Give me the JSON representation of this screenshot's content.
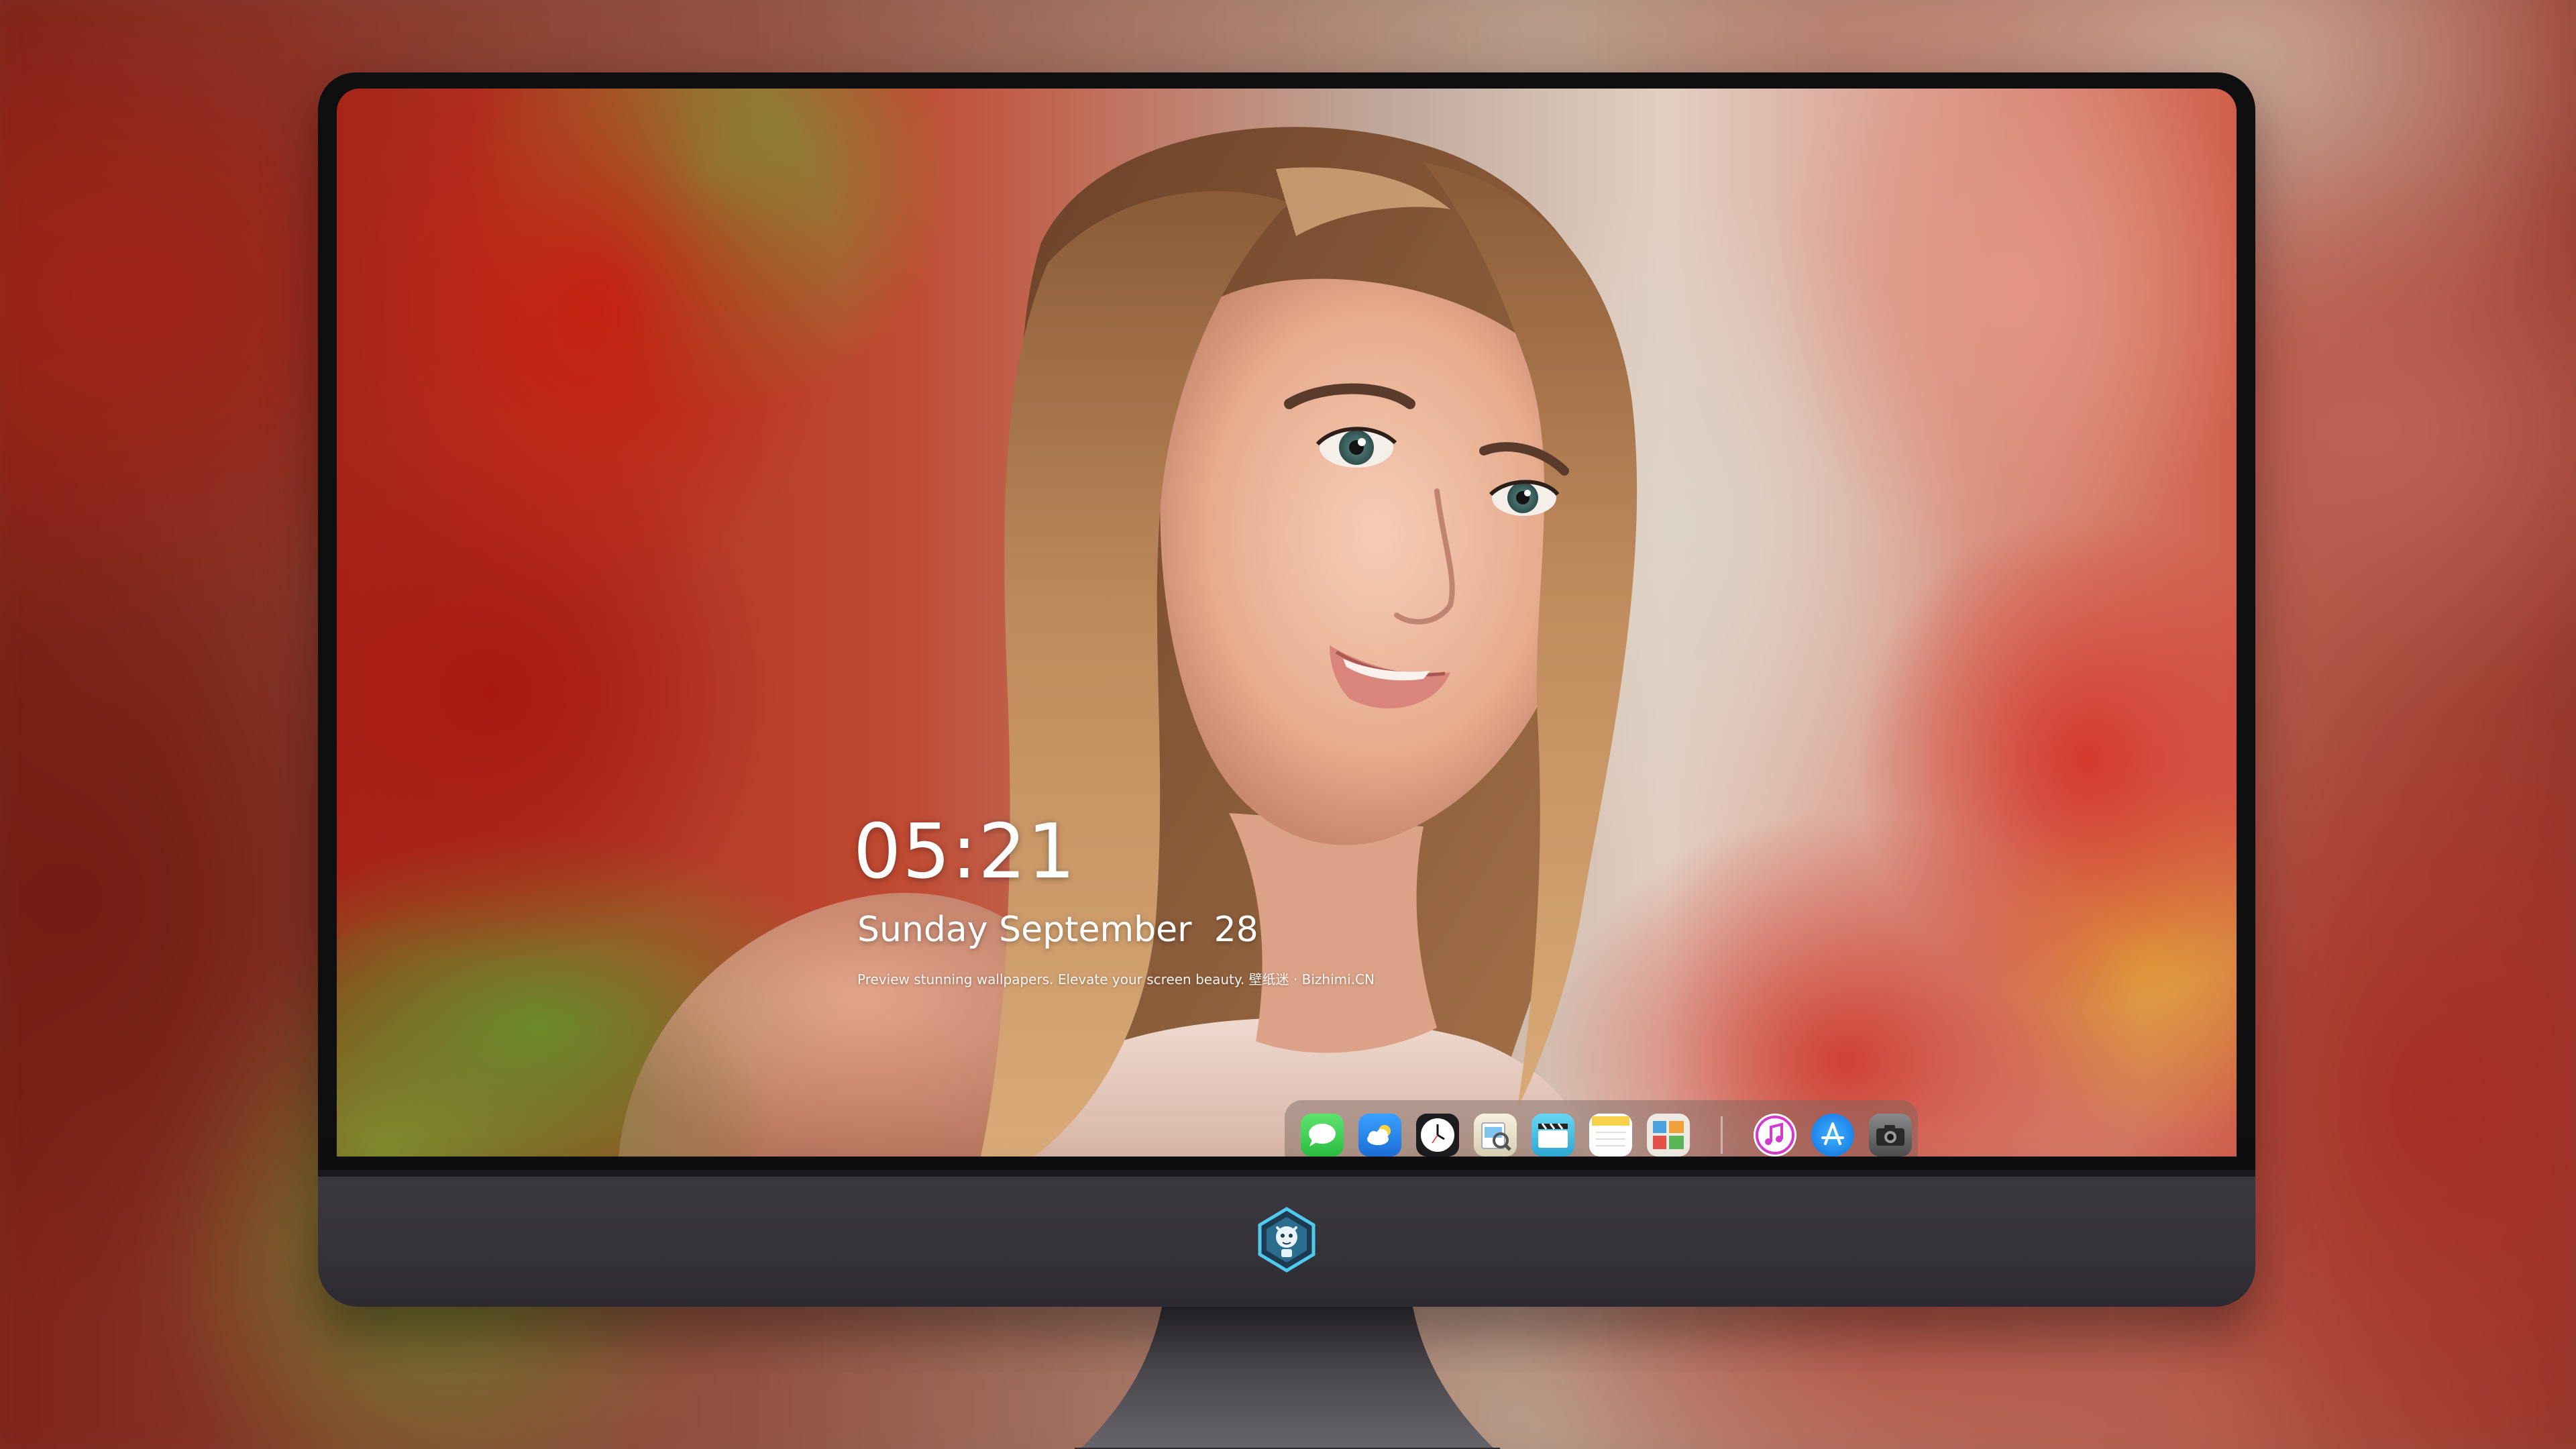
{
  "lockscreen": {
    "time": "05:21",
    "date": "Sunday September  28",
    "tagline": "Preview stunning wallpapers. Elevate your screen beauty. 壁纸迷 · Bizhimi.CN"
  },
  "dock": {
    "apps": [
      {
        "name": "Messages",
        "icon": "messages-icon",
        "color": "#35c759"
      },
      {
        "name": "Weather",
        "icon": "weather-icon",
        "color": "#2f8cf0"
      },
      {
        "name": "Clock",
        "icon": "clock-icon",
        "color": "#1c1c1e"
      },
      {
        "name": "Preview",
        "icon": "preview-icon",
        "color": "#f2c94c"
      },
      {
        "name": "Clips",
        "icon": "clapperboard-icon",
        "color": "#4fc3e8"
      },
      {
        "name": "Notes",
        "icon": "notes-icon",
        "color": "#f7d55a"
      },
      {
        "name": "Photo Booth",
        "icon": "photo-collage-icon",
        "color": "#e9e4dc"
      },
      {
        "name": "iTunes",
        "icon": "music-note-icon",
        "color": "#d63ad1"
      },
      {
        "name": "App Store",
        "icon": "app-store-icon",
        "color": "#1e8ef5"
      },
      {
        "name": "Camera",
        "icon": "camera-icon",
        "color": "#6d6d70"
      }
    ]
  },
  "monitor": {
    "logo": "bizhimi-dragon-logo"
  }
}
